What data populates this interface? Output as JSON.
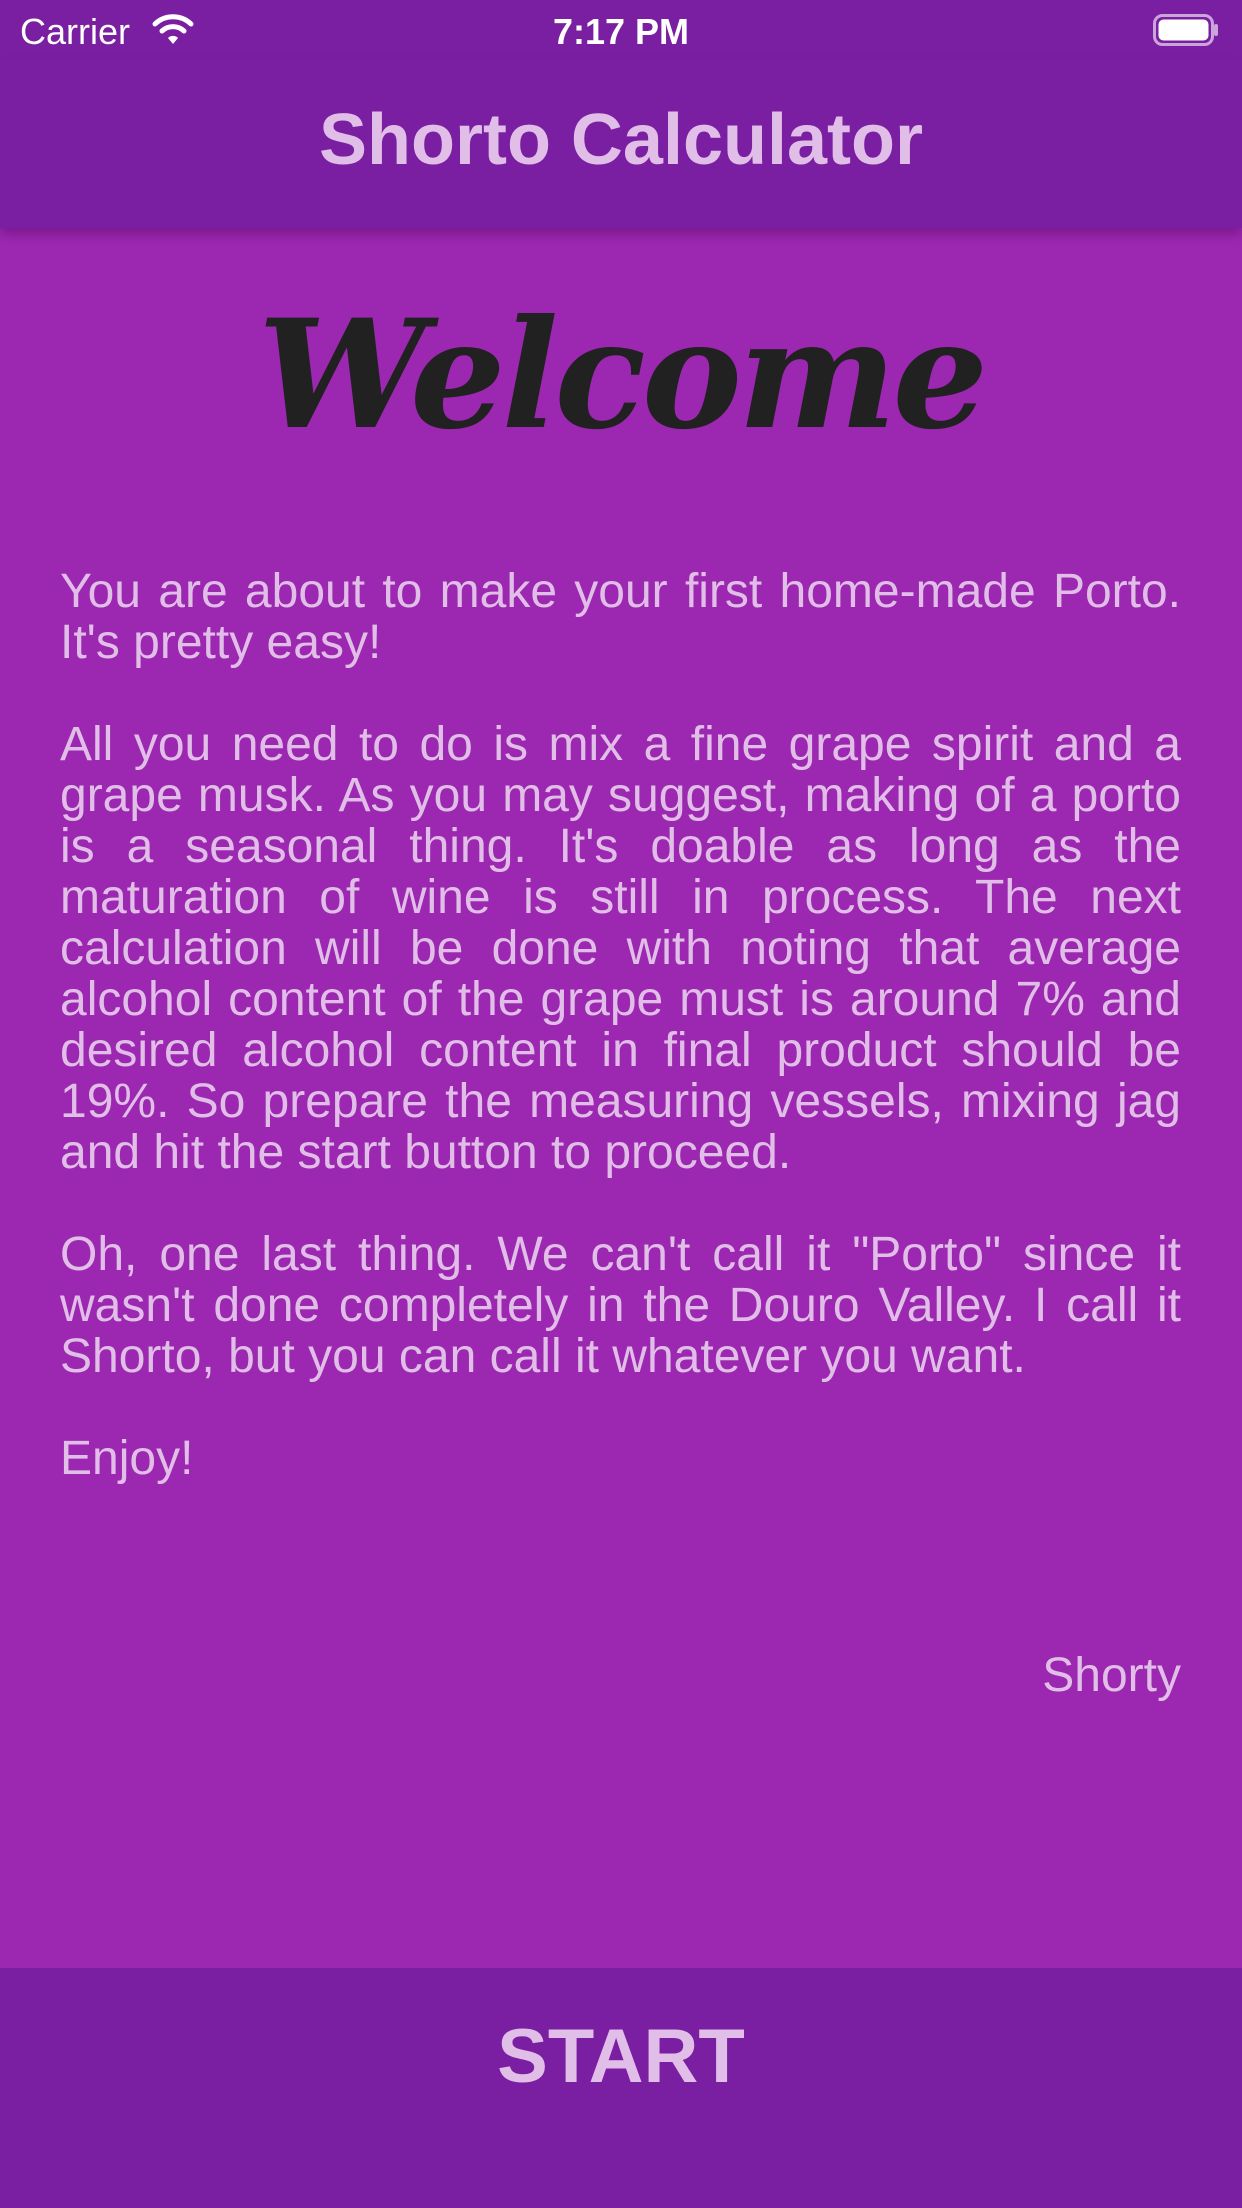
{
  "status_bar": {
    "carrier": "Carrier",
    "time": "7:17 PM",
    "wifi_icon": "wifi-icon",
    "battery_icon": "battery-icon"
  },
  "nav": {
    "title": "Shorto Calculator"
  },
  "welcome_title": "Welcome",
  "paragraphs": [
    "You are about to make your first home-made Porto. It's pretty easy!",
    "All you need to do is mix a fine grape spirit and a grape musk. As you may suggest, making of a porto is a seasonal thing. It's doable as long as the maturation of wine is still in process. The next calculation will be done with noting that average alcohol content of the grape must is around 7% and desired alcohol content in final product should be 19%. So prepare the measuring vessels, mixing jag and hit the start button to proceed.",
    "Oh, one last thing. We can't call it \"Porto\" since it wasn't done completely in the Douro Valley. I call it Shorto, but you can call it whatever you want.",
    "Enjoy!"
  ],
  "signature": "Shorty",
  "start_button": {
    "label": "START"
  },
  "colors": {
    "background": "#9c27b0",
    "bar": "#7b1fa2",
    "text": "#e1bee7",
    "welcome": "#212121"
  }
}
